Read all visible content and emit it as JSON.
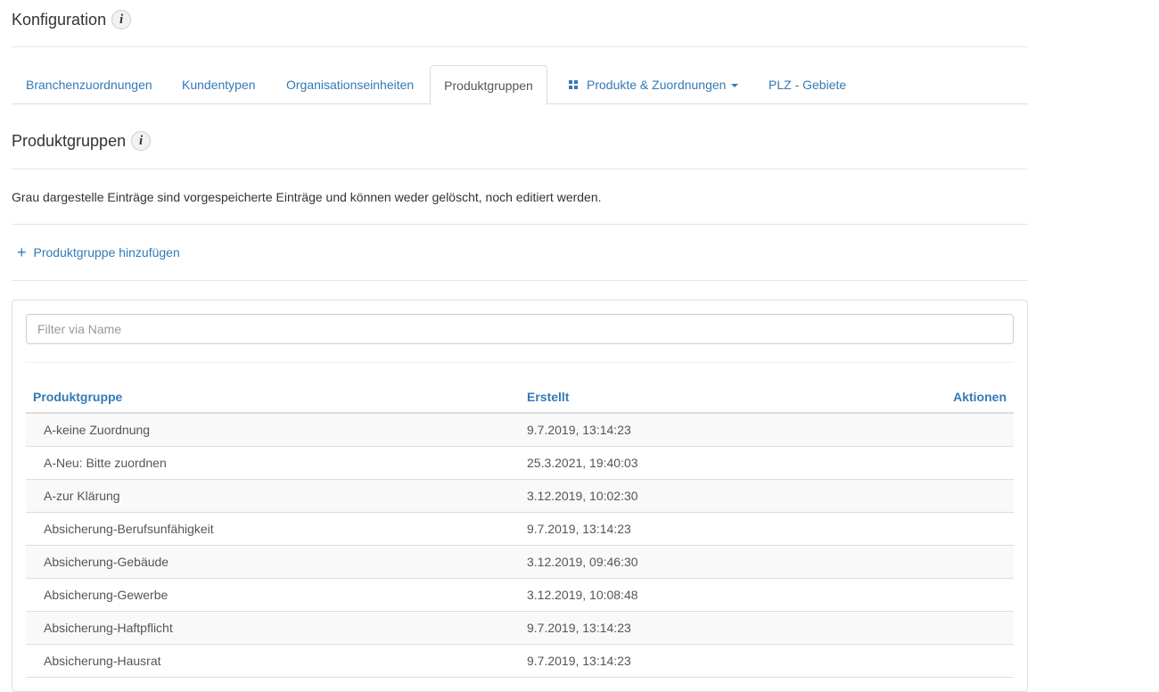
{
  "page": {
    "title": "Konfiguration",
    "info_glyph": "i"
  },
  "tabs": [
    {
      "label": "Branchenzuordnungen",
      "active": false
    },
    {
      "label": "Kundentypen",
      "active": false
    },
    {
      "label": "Organisationseinheiten",
      "active": false
    },
    {
      "label": "Produktgruppen",
      "active": true
    },
    {
      "label": "Produkte & Zuordnungen",
      "active": false,
      "icon": "grid-icon",
      "dropdown": true
    },
    {
      "label": "PLZ - Gebiete",
      "active": false
    }
  ],
  "section": {
    "title": "Produktgruppen",
    "info_glyph": "i",
    "note": "Grau dargestelle Einträge sind vorgespeicherte Einträge und können weder gelöscht, noch editiert werden.",
    "add_icon": "plus-icon",
    "add_label": "Produktgruppe hinzufügen"
  },
  "filter": {
    "placeholder": "Filter via Name",
    "value": ""
  },
  "table": {
    "headers": {
      "name": "Produktgruppe",
      "created": "Erstellt",
      "actions": "Aktionen"
    },
    "rows": [
      {
        "name": "A-keine Zuordnung",
        "created": "9.7.2019, 13:14:23"
      },
      {
        "name": "A-Neu: Bitte zuordnen",
        "created": "25.3.2021, 19:40:03"
      },
      {
        "name": "A-zur Klärung",
        "created": "3.12.2019, 10:02:30"
      },
      {
        "name": "Absicherung-Berufsunfähigkeit",
        "created": "9.7.2019, 13:14:23"
      },
      {
        "name": "Absicherung-Gebäude",
        "created": "3.12.2019, 09:46:30"
      },
      {
        "name": "Absicherung-Gewerbe",
        "created": "3.12.2019, 10:08:48"
      },
      {
        "name": "Absicherung-Haftpflicht",
        "created": "9.7.2019, 13:14:23"
      },
      {
        "name": "Absicherung-Hausrat",
        "created": "9.7.2019, 13:14:23"
      }
    ]
  },
  "colors": {
    "link": "#337ab7",
    "text": "#333333",
    "muted": "#555555",
    "border": "#dddddd",
    "stripe": "#f9f9f9"
  }
}
